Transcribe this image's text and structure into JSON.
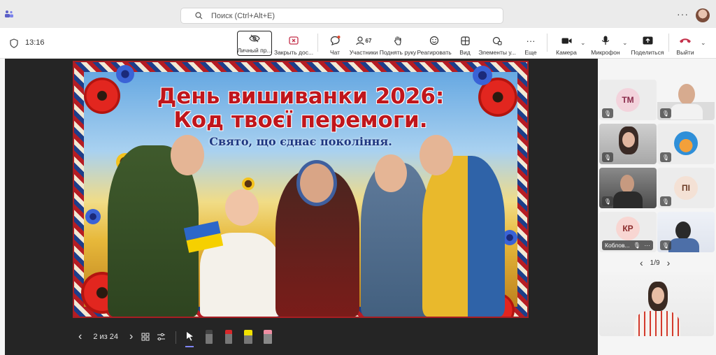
{
  "titlebar": {
    "search_placeholder": "Поиск (Ctrl+Alt+E)",
    "more": "···"
  },
  "toolbar": {
    "clock": "13:16",
    "buttons": {
      "personal": "Личный пр...",
      "close_share": "Закрыть дос...",
      "chat": "Чат",
      "participants": "Участники",
      "participants_count": "67",
      "raise_hand": "Поднять руку",
      "react": "Реагировать",
      "view": "Вид",
      "apps": "Элементы у...",
      "more": "Еще",
      "camera": "Камера",
      "mic": "Микрофон",
      "share": "Поделиться",
      "leave": "Выйти"
    }
  },
  "slide": {
    "title_line1": "День вишиванки 2026:",
    "title_line2": "Код твоєї перемоги.",
    "subtitle": "Свято, що єднає покоління."
  },
  "slide_controls": {
    "counter": "2 из 24",
    "prev": "‹",
    "next": "›"
  },
  "participants": {
    "tiles": [
      {
        "initials": "TM",
        "color": "#f3d3dc",
        "text_color": "#8a2b4b"
      },
      {
        "initials": "",
        "type": "video"
      },
      {
        "initials": "",
        "type": "video"
      },
      {
        "initials": "",
        "type": "avatar"
      },
      {
        "initials": "",
        "type": "video"
      },
      {
        "initials": "ПІ",
        "color": "#f4e1d5",
        "text_color": "#6b3b25"
      },
      {
        "initials": "КР",
        "color": "#f8d6d2",
        "text_color": "#8a2b2b",
        "name": "Коблов..."
      },
      {
        "initials": "",
        "type": "video"
      }
    ],
    "pager": "1/9",
    "pager_prev": "‹",
    "pager_next": "›"
  },
  "colors": {
    "accent": "#5b5fc7",
    "leave_red": "#c4314b",
    "slide_title_red": "#c0161c",
    "slide_subtitle_blue": "#1e3781"
  }
}
